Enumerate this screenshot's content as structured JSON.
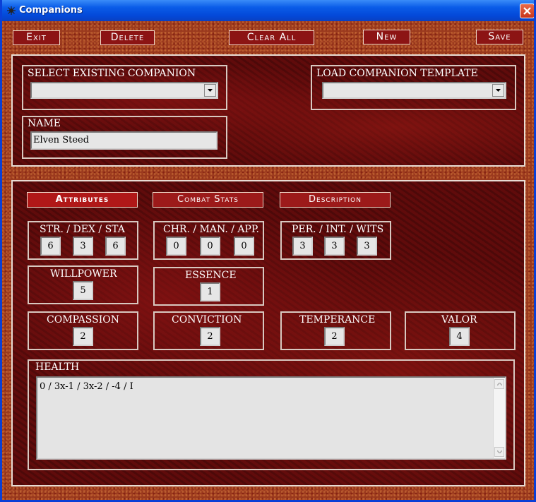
{
  "window": {
    "title": "Companions"
  },
  "toolbar": {
    "exit": "Exit",
    "delete": "Delete",
    "clear_all": "Clear All",
    "new": "New",
    "save": "Save"
  },
  "select_existing": {
    "label": "SELECT EXISTING COMPANION",
    "value": ""
  },
  "load_template": {
    "label": "LOAD COMPANION TEMPLATE",
    "value": ""
  },
  "name": {
    "label": "NAME",
    "value": "Elven Steed"
  },
  "tabs": [
    {
      "label": "Attributes",
      "active": true
    },
    {
      "label": "Combat Stats",
      "active": false
    },
    {
      "label": "Description",
      "active": false
    }
  ],
  "physical": {
    "label": "STR. / DEX / STA",
    "values": [
      "6",
      "3",
      "6"
    ]
  },
  "social": {
    "label": "CHR. / MAN. / APP.",
    "values": [
      "0",
      "0",
      "0"
    ]
  },
  "mental": {
    "label": "PER. / INT. / WITS",
    "values": [
      "3",
      "3",
      "3"
    ]
  },
  "willpower": {
    "label": "WILLPOWER",
    "value": "5"
  },
  "essence": {
    "label": "ESSENCE",
    "value": "1"
  },
  "compassion": {
    "label": "COMPASSION",
    "value": "2"
  },
  "conviction": {
    "label": "CONVICTION",
    "value": "2"
  },
  "temperance": {
    "label": "TEMPERANCE",
    "value": "2"
  },
  "valor": {
    "label": "VALOR",
    "value": "4"
  },
  "health": {
    "label": "HEALTH",
    "value": "0 / 3x-1 / 3x-2 / -4 / I"
  }
}
